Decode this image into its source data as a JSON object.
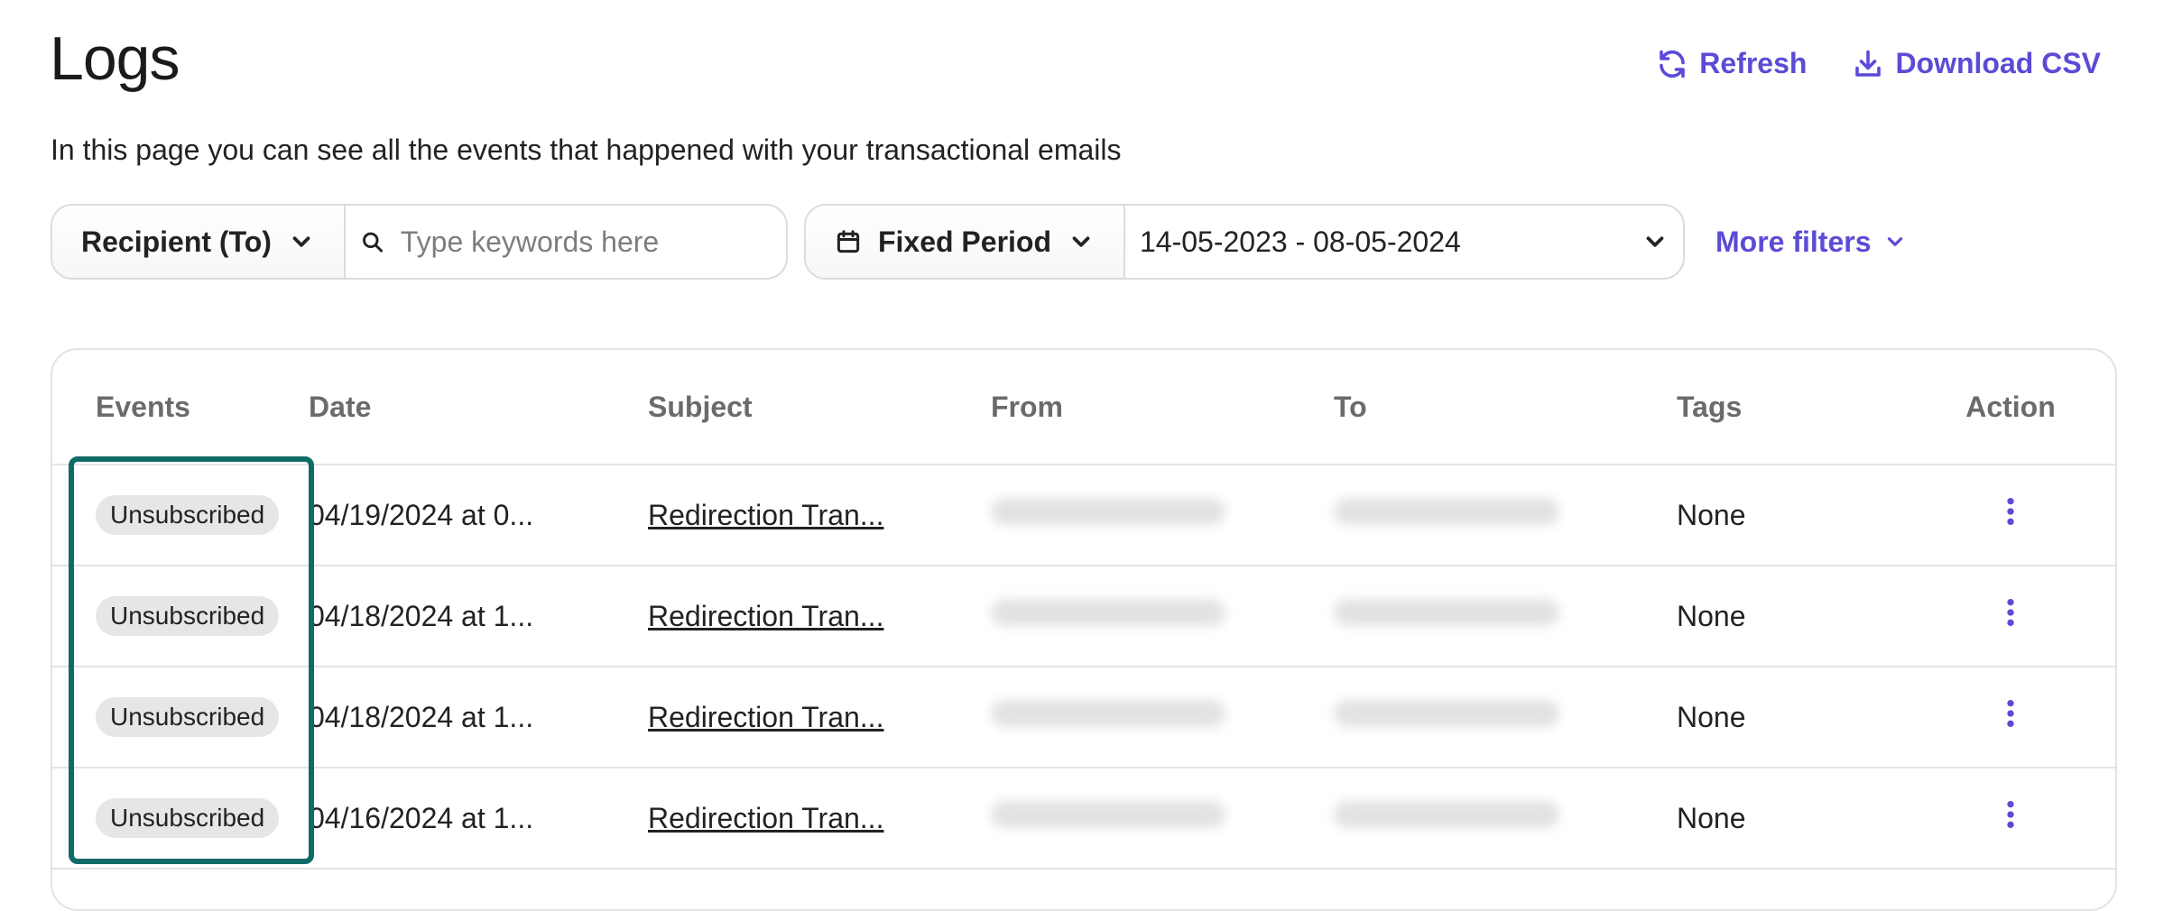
{
  "header": {
    "title": "Logs",
    "refresh_label": "Refresh",
    "download_label": "Download CSV",
    "subtitle": "In this page you can see all the events that happened with your transactional emails"
  },
  "filters": {
    "field_select": "Recipient (To)",
    "search_placeholder": "Type keywords here",
    "period_select": "Fixed Period",
    "date_range": "14-05-2023 - 08-05-2024",
    "more_filters": "More filters"
  },
  "table": {
    "headers": {
      "events": "Events",
      "date": "Date",
      "subject": "Subject",
      "from": "From",
      "to": "To",
      "tags": "Tags",
      "action": "Action"
    },
    "rows": [
      {
        "event": "Unsubscribed",
        "date": "04/19/2024 at 0...",
        "subject": "Redirection Tran...",
        "tags": "None"
      },
      {
        "event": "Unsubscribed",
        "date": "04/18/2024 at 1...",
        "subject": "Redirection Tran...",
        "tags": "None"
      },
      {
        "event": "Unsubscribed",
        "date": "04/18/2024 at 1...",
        "subject": "Redirection Tran...",
        "tags": "None"
      },
      {
        "event": "Unsubscribed",
        "date": "04/16/2024 at 1...",
        "subject": "Redirection Tran...",
        "tags": "None"
      }
    ]
  },
  "colors": {
    "accent": "#5b4bd6",
    "highlight_border": "#106b66",
    "badge_bg": "#e6e6e6"
  },
  "icons": {
    "refresh": "refresh-icon",
    "download": "download-icon",
    "search": "search-icon",
    "calendar": "calendar-icon",
    "chevron": "chevron-down-icon",
    "kebab": "kebab-menu-icon"
  }
}
